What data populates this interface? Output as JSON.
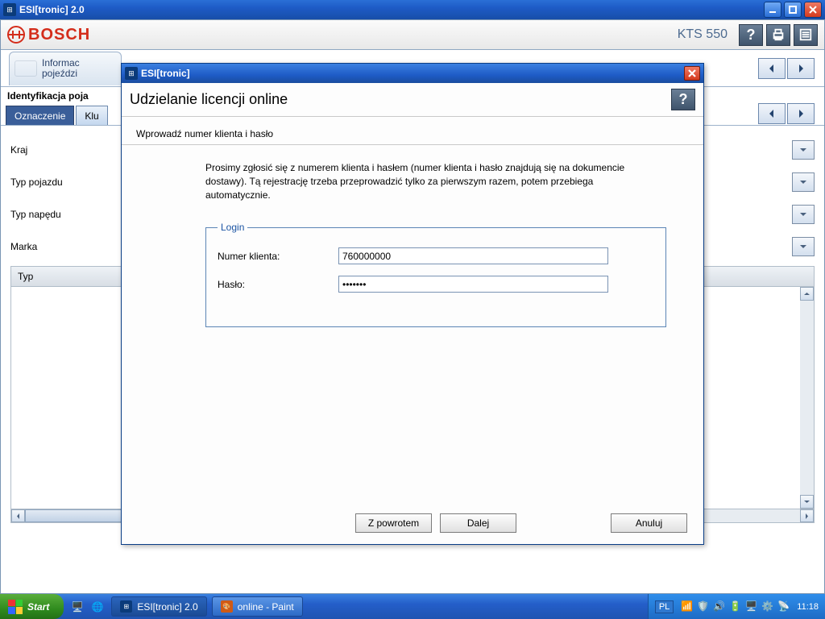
{
  "outerWindow": {
    "title": "ESI[tronic] 2.0"
  },
  "header": {
    "brand": "BOSCH",
    "device": "KTS 550"
  },
  "tabs": {
    "main_0_l1": "Informac",
    "main_0_l2": "pojeździ"
  },
  "subBar": "Identyfikacja poja",
  "smallTabs": {
    "t0": "Oznaczenie",
    "t1": "Klu"
  },
  "form": {
    "kraj": "Kraj",
    "typPojazdu": "Typ pojazdu",
    "typNapedu": "Typ napędu",
    "marka": "Marka",
    "typ": "Typ"
  },
  "dialog": {
    "title": "ESI[tronic]",
    "heading": "Udzielanie licencji online",
    "subhead": "Wprowadź numer klienta i hasło",
    "instruction": "Prosimy zgłosić się z numerem klienta i hasłem (numer klienta i hasło znajdują się na dokumencie dostawy). Tą rejestrację trzeba przeprowadzić tylko za pierwszym razem, potem przebiega automatycznie.",
    "legend": "Login",
    "numerLabel": "Numer klienta:",
    "numerValue": "760000000",
    "hasloLabel": "Hasło:",
    "hasloValue": "•••••••",
    "btnBack": "Z powrotem",
    "btnNext": "Dalej",
    "btnCancel": "Anuluj"
  },
  "taskbar": {
    "start": "Start",
    "task0": "ESI[tronic] 2.0",
    "task1": "online - Paint",
    "lang": "PL",
    "clock": "11:18"
  }
}
